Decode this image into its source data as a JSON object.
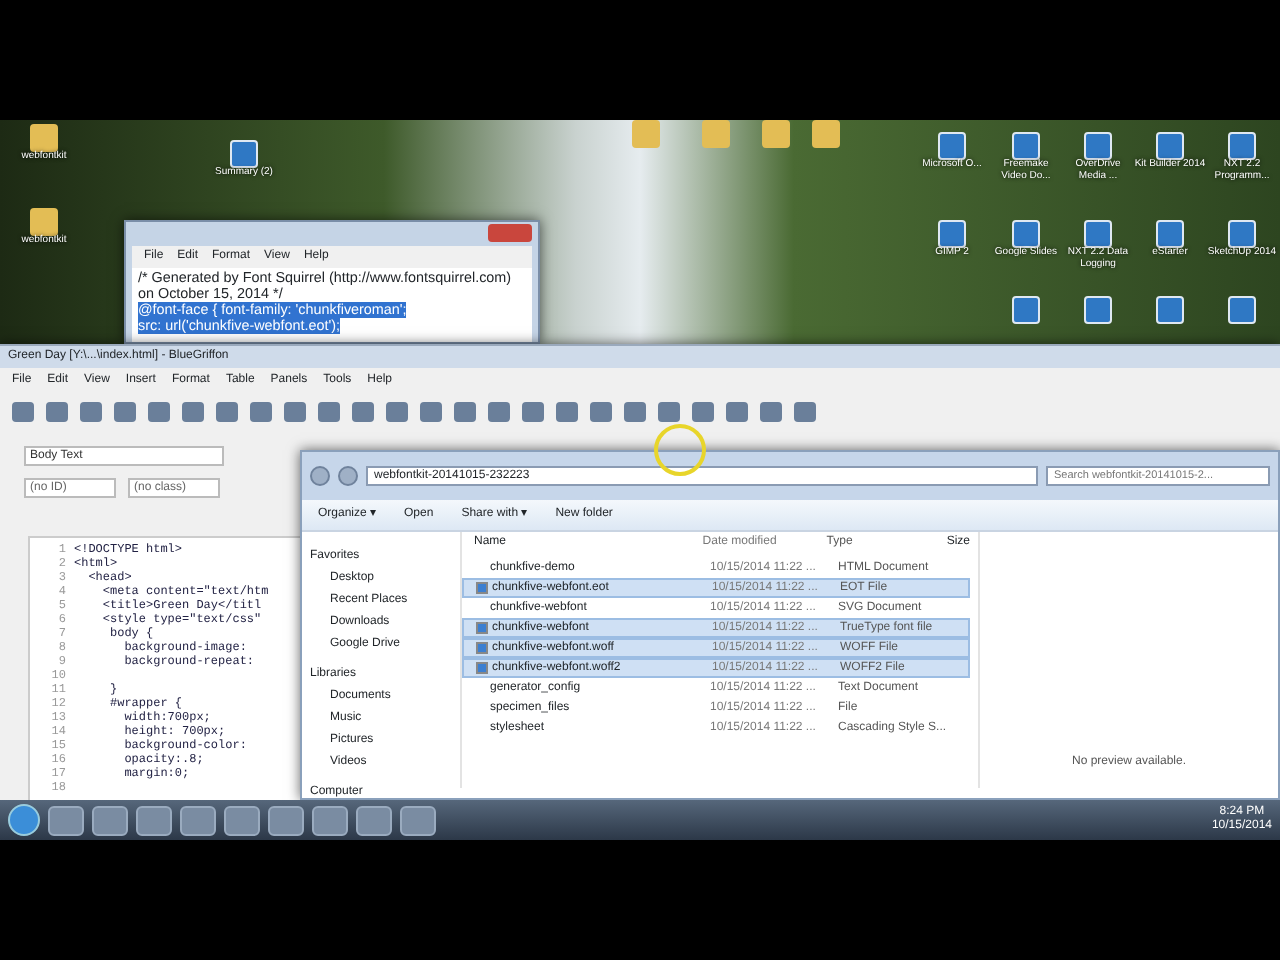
{
  "desktop": {
    "icons": [
      {
        "kind": "folder",
        "label": "webfontkit"
      },
      {
        "kind": "folder",
        "label": "webfontkit"
      },
      {
        "kind": "app",
        "label": "Summary (2)"
      },
      {
        "kind": "folder"
      },
      {
        "kind": "folder"
      },
      {
        "kind": "folder"
      },
      {
        "kind": "folder"
      },
      {
        "kind": "app",
        "label": "Microsoft O..."
      },
      {
        "kind": "app",
        "label": "Freemake Video Do..."
      },
      {
        "kind": "app",
        "label": "OverDrive Media ..."
      },
      {
        "kind": "app",
        "label": "Kit Builder 2014"
      },
      {
        "kind": "app",
        "label": "NXT 2.2 Programm..."
      },
      {
        "kind": "app",
        "label": "GIMP 2"
      },
      {
        "kind": "app",
        "label": "Google Slides"
      },
      {
        "kind": "app",
        "label": "NXT 2.2 Data Logging"
      },
      {
        "kind": "app",
        "label": "eStarter"
      },
      {
        "kind": "app",
        "label": "SketchUp 2014"
      },
      {
        "kind": "app"
      },
      {
        "kind": "app"
      },
      {
        "kind": "app"
      },
      {
        "kind": "app"
      }
    ]
  },
  "notepad": {
    "menu": [
      "File",
      "Edit",
      "Format",
      "View",
      "Help"
    ],
    "lines": [
      {
        "text": "/* Generated by Font Squirrel (http://www.fontsquirrel.com)",
        "selected": false
      },
      {
        "text": "on October 15, 2014 */",
        "selected": false
      },
      {
        "text": "@font-face {   font-family: 'chunkfiveroman';",
        "selected": true
      },
      {
        "text": "src: url('chunkfive-webfont.eot');",
        "selected": true
      }
    ]
  },
  "editor": {
    "title": "Green Day [Y:\\...\\index.html] - BlueGriffon",
    "menu": [
      "File",
      "Edit",
      "View",
      "Insert",
      "Format",
      "Table",
      "Panels",
      "Tools",
      "Help"
    ],
    "style_select": "Body Text",
    "id_select": "(no ID)",
    "class_select": "(no class)",
    "code": [
      {
        "number": "1",
        "text": "<!DOCTYPE html>"
      },
      {
        "number": "2",
        "text": "<html>"
      },
      {
        "number": "3",
        "text": "  <head>"
      },
      {
        "number": "4",
        "text": "    <meta content=\"text/htm"
      },
      {
        "number": "5",
        "text": "    <title>Green Day</titl"
      },
      {
        "number": "6",
        "text": "    <style type=\"text/css\""
      },
      {
        "number": "7",
        "text": "     body {"
      },
      {
        "number": "8",
        "text": "       background-image: "
      },
      {
        "number": "9",
        "text": "       background-repeat:"
      },
      {
        "number": "10"
      },
      {
        "number": "11",
        "text": "     }"
      },
      {
        "number": "12",
        "text": "     #wrapper {"
      },
      {
        "number": "13",
        "text": "       width:700px;"
      },
      {
        "number": "14",
        "text": "       height: 700px;"
      },
      {
        "number": "15",
        "text": "       background-color: "
      },
      {
        "number": "16",
        "text": "       opacity:.8;"
      },
      {
        "number": "17",
        "text": "       margin:0;"
      },
      {
        "number": "18"
      }
    ]
  },
  "explorer": {
    "address": "webfontkit-20141015-232223",
    "search_placeholder": "Search webfontkit-20141015-2...",
    "toolbar": [
      "Organize ▾",
      "Open",
      "Share with ▾",
      "New folder"
    ],
    "nav": [
      {
        "kind": "group",
        "label": "Favorites"
      },
      {
        "kind": "item",
        "label": "Desktop"
      },
      {
        "kind": "item",
        "label": "Recent Places"
      },
      {
        "kind": "item",
        "label": "Downloads"
      },
      {
        "kind": "item",
        "label": "Google Drive"
      },
      {
        "kind": "group",
        "label": "Libraries"
      },
      {
        "kind": "item",
        "label": "Documents"
      },
      {
        "kind": "item",
        "label": "Music"
      },
      {
        "kind": "item",
        "label": "Pictures"
      },
      {
        "kind": "item",
        "label": "Videos"
      },
      {
        "kind": "group",
        "label": "Computer"
      }
    ],
    "columns": [
      "Name",
      "Date modified",
      "Type",
      "Size"
    ],
    "rows": [
      {
        "name": "chunkfive-demo",
        "date": "10/15/2014 11:22 ...",
        "type": "HTML Document",
        "selected": false
      },
      {
        "name": "chunkfive-webfont.eot",
        "date": "10/15/2014 11:22 ...",
        "type": "EOT File",
        "selected": true
      },
      {
        "name": "chunkfive-webfont",
        "date": "10/15/2014 11:22 ...",
        "type": "SVG Document",
        "selected": false
      },
      {
        "name": "chunkfive-webfont",
        "date": "10/15/2014 11:22 ...",
        "type": "TrueType font file",
        "selected": true
      },
      {
        "name": "chunkfive-webfont.woff",
        "date": "10/15/2014 11:22 ...",
        "type": "WOFF File",
        "selected": true
      },
      {
        "name": "chunkfive-webfont.woff2",
        "date": "10/15/2014 11:22 ...",
        "type": "WOFF2 File",
        "selected": true
      },
      {
        "name": "generator_config",
        "date": "10/15/2014 11:22 ...",
        "type": "Text Document",
        "selected": false
      },
      {
        "name": "specimen_files",
        "date": "10/15/2014 11:22 ...",
        "type": "File",
        "selected": false
      },
      {
        "name": "stylesheet",
        "date": "10/15/2014 11:22 ...",
        "type": "Cascading Style S...",
        "selected": false
      }
    ],
    "preview": "No preview available."
  },
  "taskbar": {
    "time": "8:24 PM",
    "date": "10/15/2014"
  }
}
